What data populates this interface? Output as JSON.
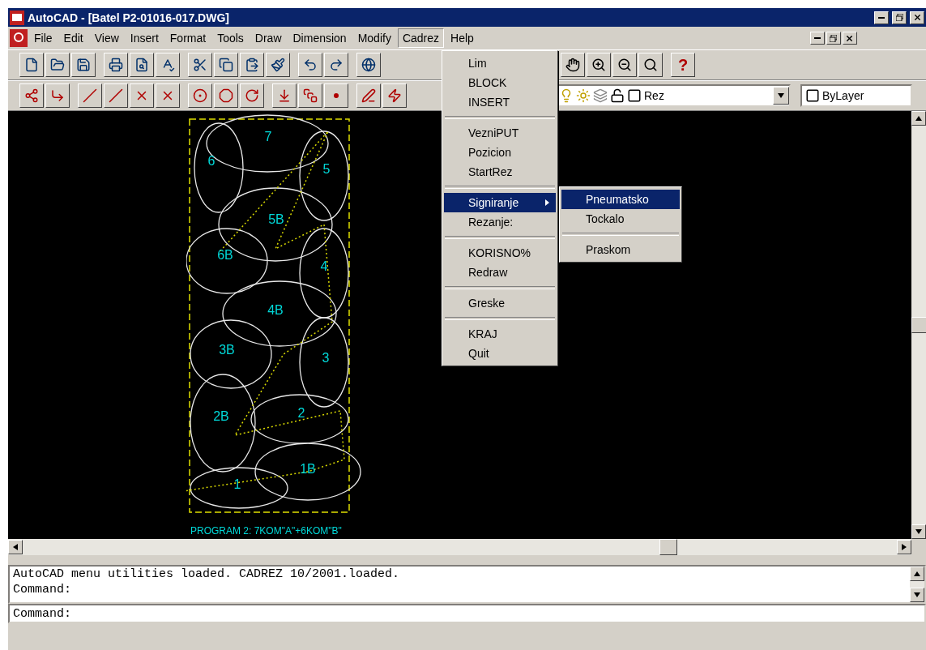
{
  "window": {
    "title": "AutoCAD - [Batel P2-01016-017.DWG]"
  },
  "menu_bar": [
    {
      "label": "File",
      "selected": false
    },
    {
      "label": "Edit",
      "selected": false
    },
    {
      "label": "View",
      "selected": false
    },
    {
      "label": "Insert",
      "selected": false
    },
    {
      "label": "Format",
      "selected": false
    },
    {
      "label": "Tools",
      "selected": false
    },
    {
      "label": "Draw",
      "selected": false
    },
    {
      "label": "Dimension",
      "selected": false
    },
    {
      "label": "Modify",
      "selected": false
    },
    {
      "label": "Cadrez",
      "selected": true
    },
    {
      "label": "Help",
      "selected": false
    }
  ],
  "help_button": "?",
  "layer_combo": {
    "value": "Rez"
  },
  "color_combo": {
    "value": "ByLayer"
  },
  "cadrez_menu": [
    [
      {
        "label": "Lim",
        "selected": false,
        "submenu": false
      },
      {
        "label": "BLOCK",
        "selected": false,
        "submenu": false
      },
      {
        "label": "INSERT",
        "selected": false,
        "submenu": false
      }
    ],
    [
      {
        "label": "VezniPUT",
        "selected": false,
        "submenu": false
      },
      {
        "label": "Pozicion",
        "selected": false,
        "submenu": false
      },
      {
        "label": "StartRez",
        "selected": false,
        "submenu": false
      }
    ],
    [
      {
        "label": "Signiranje",
        "selected": true,
        "submenu": true
      },
      {
        "label": "Rezanje:",
        "selected": false,
        "submenu": false
      }
    ],
    [
      {
        "label": "KORISNO%",
        "selected": false,
        "submenu": false
      },
      {
        "label": "Redraw",
        "selected": false,
        "submenu": false
      }
    ],
    [
      {
        "label": "Greske",
        "selected": false,
        "submenu": false
      }
    ],
    [
      {
        "label": "KRAJ",
        "selected": false,
        "submenu": false
      },
      {
        "label": "Quit",
        "selected": false,
        "submenu": false
      }
    ]
  ],
  "signiranje_submenu": [
    [
      {
        "label": "Pneumatsko",
        "selected": true
      },
      {
        "label": "Tockalo",
        "selected": false
      }
    ],
    [
      {
        "label": "Praskom",
        "selected": false
      }
    ]
  ],
  "drawing": {
    "part_labels": [
      "7",
      "6",
      "5",
      "5B",
      "6B",
      "4",
      "4B",
      "3B",
      "3",
      "2B",
      "2",
      "1B",
      "1"
    ],
    "caption": "PROGRAM 2: 7KOM\"A\"+6KOM\"B\""
  },
  "command_window": {
    "history": [
      "AutoCAD menu utilities loaded. CADREZ 10/2001.loaded.",
      "Command:"
    ],
    "prompt": "Command:"
  }
}
